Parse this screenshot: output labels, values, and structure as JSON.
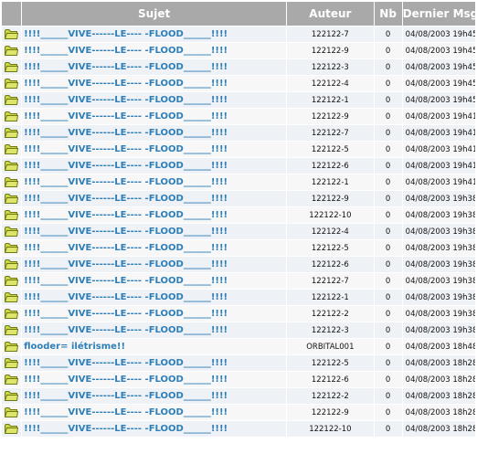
{
  "header": {
    "icon_label": "",
    "subject_label": "Sujet",
    "author_label": "Auteur",
    "nb_label": "Nb",
    "date_label": "Dernier Msg"
  },
  "colors": {
    "header_bg": "#a9a9a9",
    "link": "#2e7fb8",
    "folder_fill": "#c9d64a",
    "folder_stroke": "#6f7a12"
  },
  "rows_icon": "folder-icon",
  "rows": [
    {
      "subject": "!!!!______VIVE------LE---- -FLOOD______!!!!",
      "author": "122122-7",
      "nb": "0",
      "date": "04/08/2003 19h45"
    },
    {
      "subject": "!!!!______VIVE------LE---- -FLOOD______!!!!",
      "author": "122122-9",
      "nb": "0",
      "date": "04/08/2003 19h45"
    },
    {
      "subject": "!!!!______VIVE------LE---- -FLOOD______!!!!",
      "author": "122122-3",
      "nb": "0",
      "date": "04/08/2003 19h45"
    },
    {
      "subject": "!!!!______VIVE------LE---- -FLOOD______!!!!",
      "author": "122122-4",
      "nb": "0",
      "date": "04/08/2003 19h45"
    },
    {
      "subject": "!!!!______VIVE------LE---- -FLOOD______!!!!",
      "author": "122122-1",
      "nb": "0",
      "date": "04/08/2003 19h45"
    },
    {
      "subject": "!!!!______VIVE------LE---- -FLOOD______!!!!",
      "author": "122122-9",
      "nb": "0",
      "date": "04/08/2003 19h41"
    },
    {
      "subject": "!!!!______VIVE------LE---- -FLOOD______!!!!",
      "author": "122122-7",
      "nb": "0",
      "date": "04/08/2003 19h41"
    },
    {
      "subject": "!!!!______VIVE------LE---- -FLOOD______!!!!",
      "author": "122122-5",
      "nb": "0",
      "date": "04/08/2003 19h41"
    },
    {
      "subject": "!!!!______VIVE------LE---- -FLOOD______!!!!",
      "author": "122122-6",
      "nb": "0",
      "date": "04/08/2003 19h41"
    },
    {
      "subject": "!!!!______VIVE------LE---- -FLOOD______!!!!",
      "author": "122122-1",
      "nb": "0",
      "date": "04/08/2003 19h41"
    },
    {
      "subject": "!!!!______VIVE------LE---- -FLOOD______!!!!",
      "author": "122122-9",
      "nb": "0",
      "date": "04/08/2003 19h38"
    },
    {
      "subject": "!!!!______VIVE------LE---- -FLOOD______!!!!",
      "author": "122122-10",
      "nb": "0",
      "date": "04/08/2003 19h38"
    },
    {
      "subject": "!!!!______VIVE------LE---- -FLOOD______!!!!",
      "author": "122122-4",
      "nb": "0",
      "date": "04/08/2003 19h38"
    },
    {
      "subject": "!!!!______VIVE------LE---- -FLOOD______!!!!",
      "author": "122122-5",
      "nb": "0",
      "date": "04/08/2003 19h38"
    },
    {
      "subject": "!!!!______VIVE------LE---- -FLOOD______!!!!",
      "author": "122122-6",
      "nb": "0",
      "date": "04/08/2003 19h38"
    },
    {
      "subject": "!!!!______VIVE------LE---- -FLOOD______!!!!",
      "author": "122122-7",
      "nb": "0",
      "date": "04/08/2003 19h38"
    },
    {
      "subject": "!!!!______VIVE------LE---- -FLOOD______!!!!",
      "author": "122122-1",
      "nb": "0",
      "date": "04/08/2003 19h38"
    },
    {
      "subject": "!!!!______VIVE------LE---- -FLOOD______!!!!",
      "author": "122122-2",
      "nb": "0",
      "date": "04/08/2003 19h38"
    },
    {
      "subject": "!!!!______VIVE------LE---- -FLOOD______!!!!",
      "author": "122122-3",
      "nb": "0",
      "date": "04/08/2003 19h38"
    },
    {
      "subject": "flooder= ilétrisme!!",
      "author": "ORBITAL001",
      "nb": "0",
      "date": "04/08/2003 18h48"
    },
    {
      "subject": "!!!!______VIVE------LE---- -FLOOD______!!!!",
      "author": "122122-5",
      "nb": "0",
      "date": "04/08/2003 18h28"
    },
    {
      "subject": "!!!!______VIVE------LE---- -FLOOD______!!!!",
      "author": "122122-6",
      "nb": "0",
      "date": "04/08/2003 18h28"
    },
    {
      "subject": "!!!!______VIVE------LE---- -FLOOD______!!!!",
      "author": "122122-2",
      "nb": "0",
      "date": "04/08/2003 18h28"
    },
    {
      "subject": "!!!!______VIVE------LE---- -FLOOD______!!!!",
      "author": "122122-9",
      "nb": "0",
      "date": "04/08/2003 18h28"
    },
    {
      "subject": "!!!!______VIVE------LE---- -FLOOD______!!!!",
      "author": "122122-10",
      "nb": "0",
      "date": "04/08/2003 18h28"
    }
  ]
}
